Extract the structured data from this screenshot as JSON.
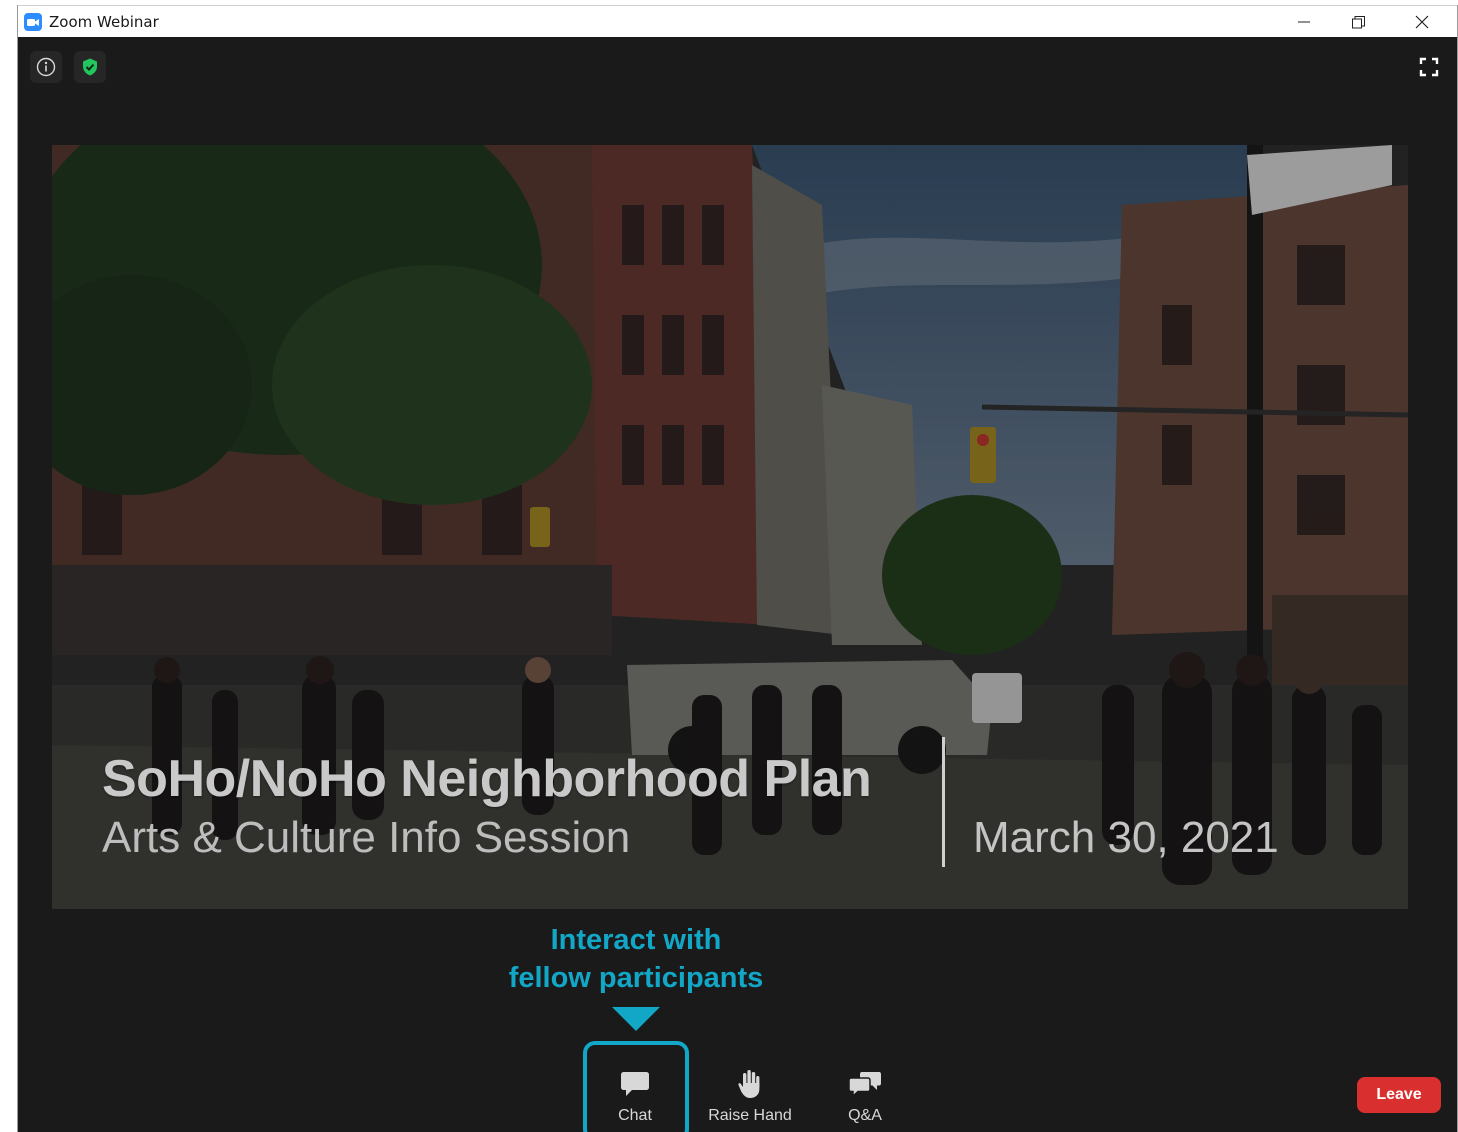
{
  "window": {
    "title": "Zoom Webinar",
    "app_icon": "zoom-camera-icon"
  },
  "top_controls": {
    "info_icon": "info-icon",
    "security_icon": "shield-check-icon",
    "fullscreen_icon": "fullscreen-icon"
  },
  "slide": {
    "title": "SoHo/NoHo Neighborhood Plan",
    "subtitle": "Arts & Culture Info Session",
    "date": "March 30, 2021"
  },
  "callout": {
    "line1": "Interact with",
    "line2": "fellow participants",
    "color": "#12a7c7"
  },
  "toolbar": {
    "items": [
      {
        "label": "Chat",
        "icon": "chat-bubble-icon"
      },
      {
        "label": "Raise Hand",
        "icon": "raised-hand-icon"
      },
      {
        "label": "Q&A",
        "icon": "qa-bubbles-icon"
      }
    ],
    "leave_label": "Leave",
    "leave_color": "#d92f2f"
  }
}
